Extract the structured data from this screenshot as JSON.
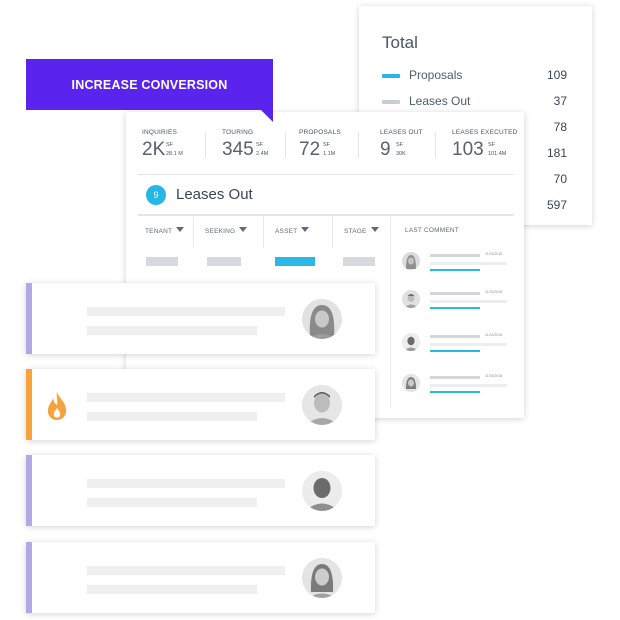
{
  "total": {
    "title": "Total",
    "rows": [
      {
        "label": "Proposals",
        "value": "109",
        "color": "#29b6e6"
      },
      {
        "label": "Leases Out",
        "value": "37",
        "color": "#c9ccd1"
      },
      {
        "label": "",
        "value": "78"
      },
      {
        "label": "",
        "value": "181"
      },
      {
        "label": "",
        "value": "70"
      },
      {
        "label": "",
        "value": "597"
      }
    ]
  },
  "banner": {
    "text": "INCREASE CONVERSION",
    "color": "#5a23ee"
  },
  "stats": [
    {
      "label": "INQUIRIES",
      "value": "2K",
      "unit1": "SF",
      "unit2": "28.1 M"
    },
    {
      "label": "TOURING",
      "value": "345",
      "unit1": "SF",
      "unit2": "2.4M"
    },
    {
      "label": "PROPOSALS",
      "value": "72",
      "unit1": "SF",
      "unit2": "1.1M"
    },
    {
      "label": "LEASES OUT",
      "value": "9",
      "unit1": "SF",
      "unit2": "30K"
    },
    {
      "label": "LEASES EXECUTED",
      "value": "103",
      "unit1": "SF",
      "unit2": "101.4M"
    }
  ],
  "leases_out": {
    "count": "9",
    "title": "Leases Out",
    "columns": [
      "TENANT",
      "SEEKING",
      "ASSET",
      "STAGE",
      "LAST COMMENT"
    ],
    "comment_dates": [
      "11/03/2018",
      "11/03/2018",
      "11/03/2018",
      "11/03/2018"
    ]
  },
  "accent_colors": {
    "purple": "#b5a6e6",
    "orange": "#f7a23b",
    "blue": "#2bb8e6"
  },
  "icons": [
    "flame-icon",
    "avatar-female",
    "avatar-male",
    "avatar-male-2",
    "avatar-female-2"
  ]
}
